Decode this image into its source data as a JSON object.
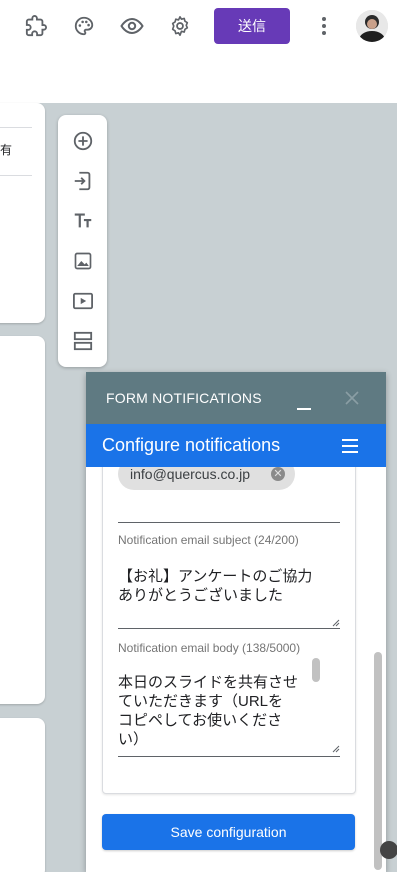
{
  "topbar": {
    "icons": [
      "puzzle-icon",
      "palette-icon",
      "eye-icon",
      "gear-icon",
      "more-vert-icon"
    ],
    "send_label": "送信"
  },
  "form_card": {
    "visible_text": "有"
  },
  "toolbar": {
    "items": [
      "add-question-icon",
      "import-questions-icon",
      "title-text-icon",
      "image-icon",
      "video-icon",
      "section-icon"
    ]
  },
  "panel": {
    "title": "FORM NOTIFICATIONS",
    "subtitle": "Configure notifications",
    "recipient_chip": "info@quercus.co.jp",
    "subject": {
      "label": "Notification email subject (24/200)",
      "value": "【お礼】アンケートのご協力\nありがとうございました"
    },
    "body": {
      "label": "Notification email body (138/5000)",
      "value": "本日のスライドを共有させ\nていただきます（URLを\nコピペしてお使いくださ\nい）"
    },
    "save_label": "Save configuration"
  },
  "colors": {
    "send_button": "#673ab7",
    "panel_header": "#5f7a82",
    "panel_subheader": "#1a73e8",
    "canvas": "#c8d0d3"
  }
}
